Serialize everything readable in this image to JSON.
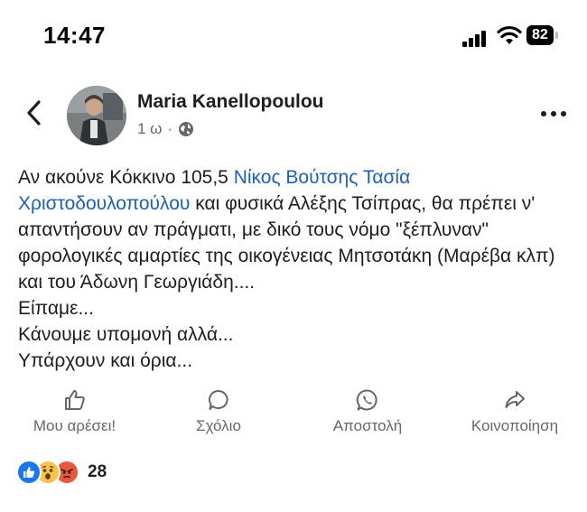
{
  "status_bar": {
    "time": "14:47",
    "battery": "82"
  },
  "post": {
    "author": "Maria Kanellopoulou",
    "age": "1 ω",
    "separator": "·",
    "audience_icon": "globe-icon",
    "text": {
      "line1_prefix": "Αν ακούνε Κόκκινο  105,5 ",
      "mention1": "Νίκος Βούτσης",
      "mention2": "Τασία Χριστοδουλοπούλου",
      "line1_suffix": " και φυσικά Αλέξης Τσίπρας,  θα πρέπει ν' απαντήσουν αν πράγματι, με δικό τους νόμο \"ξέπλυναν\" φορολογικές αμαρτίες  της οικογένειας Μητσοτάκη (Μαρέβα κλπ) και του Άδωνη Γεωργιάδη....",
      "line2": "Είπαμε...",
      "line3": "Κάνουμε υπομονή αλλά...",
      "line4": "Υπάρχουν και όρια..."
    }
  },
  "actions": {
    "like": "Μου αρέσει!",
    "comment": "Σχόλιο",
    "send": "Αποστολή",
    "share": "Κοινοποίηση"
  },
  "reactions": {
    "types": [
      "like",
      "wow",
      "angry"
    ],
    "count": "28"
  },
  "colors": {
    "link": "#1d5fbf",
    "like_blue": "#1877f2",
    "wow_yellow": "#f7c34a",
    "angry_red": "#e9573f",
    "muted": "#65676b"
  }
}
